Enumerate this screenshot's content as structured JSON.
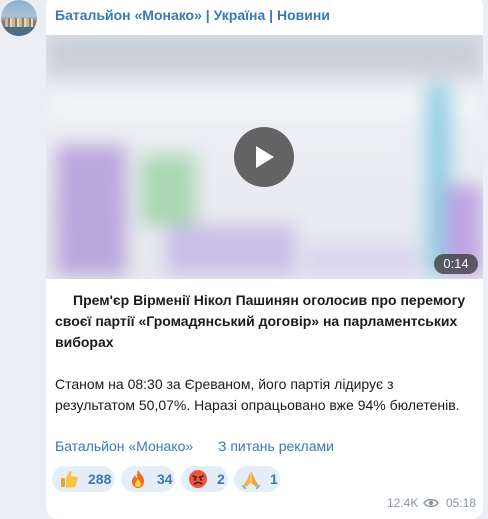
{
  "channel": {
    "name": "Батальйон «Монако» | Україна | Новини"
  },
  "video": {
    "duration": "0:14"
  },
  "message": {
    "headline": "Прем'єр Вірменії Нікол Пашинян оголосив про перемогу своєї партії «Громадянський договір» на парламентських виборах",
    "body": "Станом на 08:30 за Єреваном, його партія лідирує з результатом 50,07%. Наразі опрацьовано вже 94% бюлетенів."
  },
  "links": {
    "channel": "Батальйон «Монако»",
    "ads": "З питань реклами"
  },
  "reactions": [
    {
      "icon": "thumbs-up-icon",
      "count": "288"
    },
    {
      "icon": "fire-icon",
      "count": "34"
    },
    {
      "icon": "angry-face-icon",
      "count": "2"
    },
    {
      "icon": "praying-hands-icon",
      "count": "1"
    }
  ],
  "footer": {
    "views": "12.4K",
    "time": "05:18"
  }
}
